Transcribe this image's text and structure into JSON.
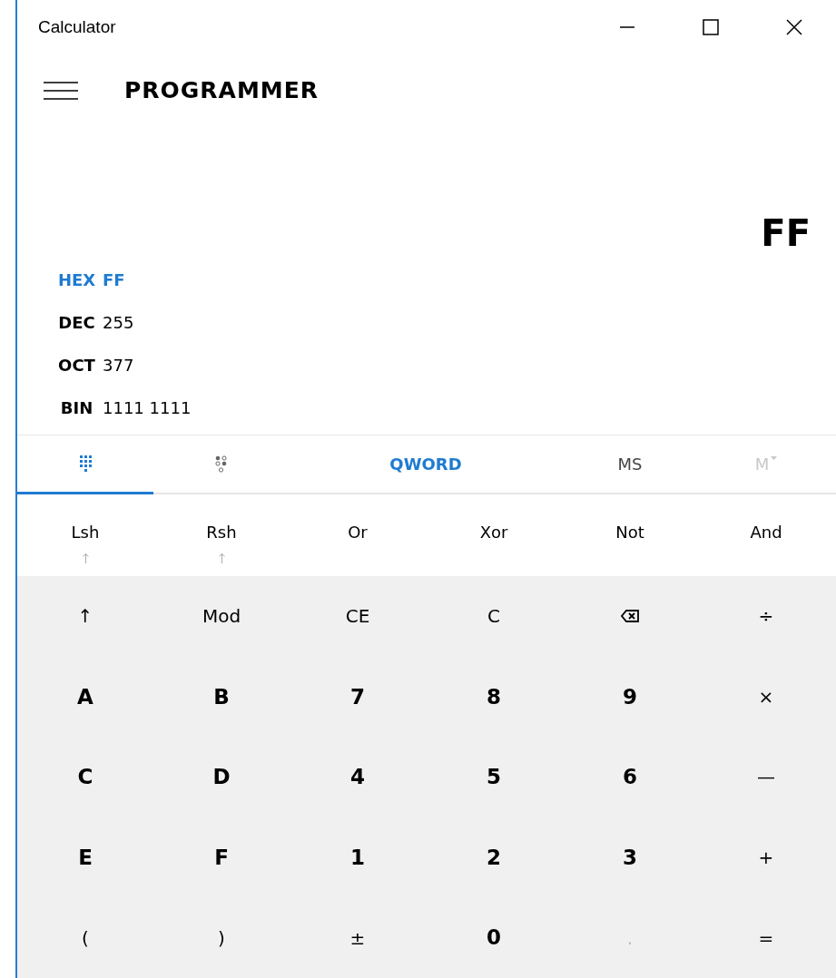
{
  "window": {
    "title": "Calculator"
  },
  "header": {
    "mode": "PROGRAMMER"
  },
  "display": {
    "value": "FF"
  },
  "radix": [
    {
      "label": "HEX",
      "value": "FF",
      "selected": true
    },
    {
      "label": "DEC",
      "value": "255",
      "selected": false
    },
    {
      "label": "OCT",
      "value": "377",
      "selected": false
    },
    {
      "label": "BIN",
      "value": "1111 1111",
      "selected": false
    }
  ],
  "toolbar": [
    {
      "kind": "keypad",
      "selected": true
    },
    {
      "kind": "bits",
      "selected": false
    },
    {
      "kind": "word-size",
      "label": "QWORD"
    },
    {
      "kind": "memory",
      "label": "MS",
      "disabled": false,
      "dropdown": false
    },
    {
      "kind": "memory",
      "label": "M",
      "disabled": true,
      "dropdown": true
    }
  ],
  "bitwise": [
    {
      "label": "Lsh",
      "shift_arrow": true
    },
    {
      "label": "Rsh",
      "shift_arrow": true
    },
    {
      "label": "Or",
      "shift_arrow": false
    },
    {
      "label": "Xor",
      "shift_arrow": false
    },
    {
      "label": "Not",
      "shift_arrow": false
    },
    {
      "label": "And",
      "shift_arrow": false
    }
  ],
  "keypad": [
    [
      {
        "kind": "op",
        "label": "↑",
        "disabled": false
      },
      {
        "kind": "op",
        "label": "Mod",
        "disabled": false
      },
      {
        "kind": "op",
        "label": "CE",
        "disabled": false
      },
      {
        "kind": "op",
        "label": "C",
        "disabled": false
      },
      {
        "kind": "backspace",
        "disabled": false
      },
      {
        "kind": "op",
        "label": "÷",
        "disabled": false
      }
    ],
    [
      {
        "kind": "digit",
        "label": "A",
        "disabled": false
      },
      {
        "kind": "digit",
        "label": "B",
        "disabled": false
      },
      {
        "kind": "digit",
        "label": "7",
        "disabled": false
      },
      {
        "kind": "digit",
        "label": "8",
        "disabled": false
      },
      {
        "kind": "digit",
        "label": "9",
        "disabled": false
      },
      {
        "kind": "op",
        "label": "×",
        "disabled": false
      }
    ],
    [
      {
        "kind": "digit",
        "label": "C",
        "disabled": false
      },
      {
        "kind": "digit",
        "label": "D",
        "disabled": false
      },
      {
        "kind": "digit",
        "label": "4",
        "disabled": false
      },
      {
        "kind": "digit",
        "label": "5",
        "disabled": false
      },
      {
        "kind": "digit",
        "label": "6",
        "disabled": false
      },
      {
        "kind": "op",
        "label": "—",
        "disabled": false
      }
    ],
    [
      {
        "kind": "digit",
        "label": "E",
        "disabled": false
      },
      {
        "kind": "digit",
        "label": "F",
        "disabled": false
      },
      {
        "kind": "digit",
        "label": "1",
        "disabled": false
      },
      {
        "kind": "digit",
        "label": "2",
        "disabled": false
      },
      {
        "kind": "digit",
        "label": "3",
        "disabled": false
      },
      {
        "kind": "op",
        "label": "+",
        "disabled": false
      }
    ],
    [
      {
        "kind": "op",
        "label": "(",
        "disabled": false
      },
      {
        "kind": "op",
        "label": ")",
        "disabled": false
      },
      {
        "kind": "op",
        "label": "±",
        "disabled": false
      },
      {
        "kind": "digit",
        "label": "0",
        "disabled": false
      },
      {
        "kind": "op",
        "label": ".",
        "disabled": true
      },
      {
        "kind": "op",
        "label": "=",
        "disabled": false
      }
    ]
  ]
}
